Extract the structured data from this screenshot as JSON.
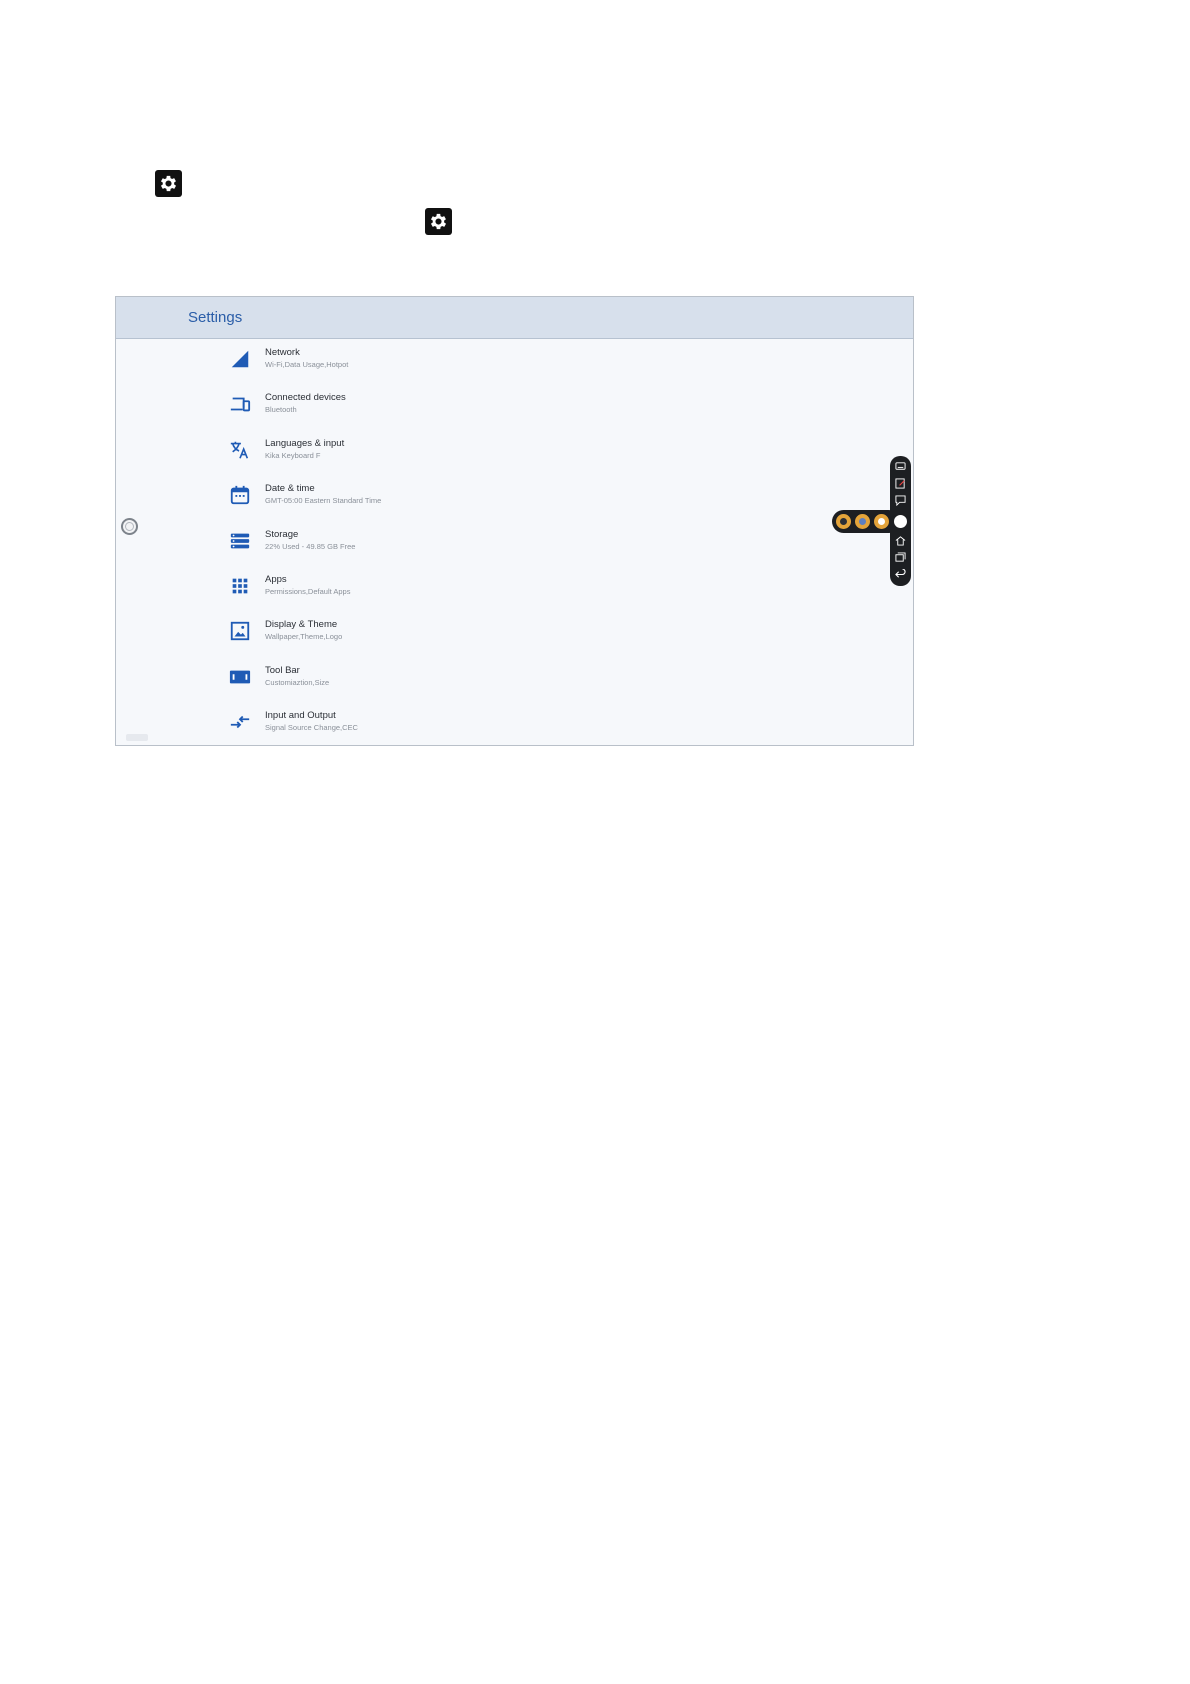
{
  "doc_icons": {
    "gear_icon_1": "gear-icon",
    "gear_icon_2": "gear-icon"
  },
  "window": {
    "title": "Settings"
  },
  "settings": {
    "items": [
      {
        "title": "Network",
        "subtitle": "Wi-Fi,Data Usage,Hotpot",
        "icon": "network-signal-icon"
      },
      {
        "title": "Connected devices",
        "subtitle": "Bluetooth",
        "icon": "devices-icon"
      },
      {
        "title": "Languages & input",
        "subtitle": "Kika Keyboard F",
        "icon": "translate-icon"
      },
      {
        "title": "Date & time",
        "subtitle": "GMT-05:00 Eastern Standard Time",
        "icon": "calendar-icon"
      },
      {
        "title": "Storage",
        "subtitle": "22% Used - 49.85 GB Free",
        "icon": "storage-icon"
      },
      {
        "title": "Apps",
        "subtitle": "Permissions,Default Apps",
        "icon": "apps-grid-icon"
      },
      {
        "title": "Display & Theme",
        "subtitle": "Wallpaper,Theme,Logo",
        "icon": "display-theme-icon"
      },
      {
        "title": "Tool Bar",
        "subtitle": "Customiaztion,Size",
        "icon": "toolbar-icon"
      },
      {
        "title": "Input and Output",
        "subtitle": "Signal Source Change,CEC",
        "icon": "input-output-icon"
      }
    ]
  },
  "colors": {
    "accent": "#1f5bb5",
    "header_bg": "#d7e0ec",
    "toolbar_bg": "#1d1f22",
    "quick_dot": "#e4a43a"
  }
}
